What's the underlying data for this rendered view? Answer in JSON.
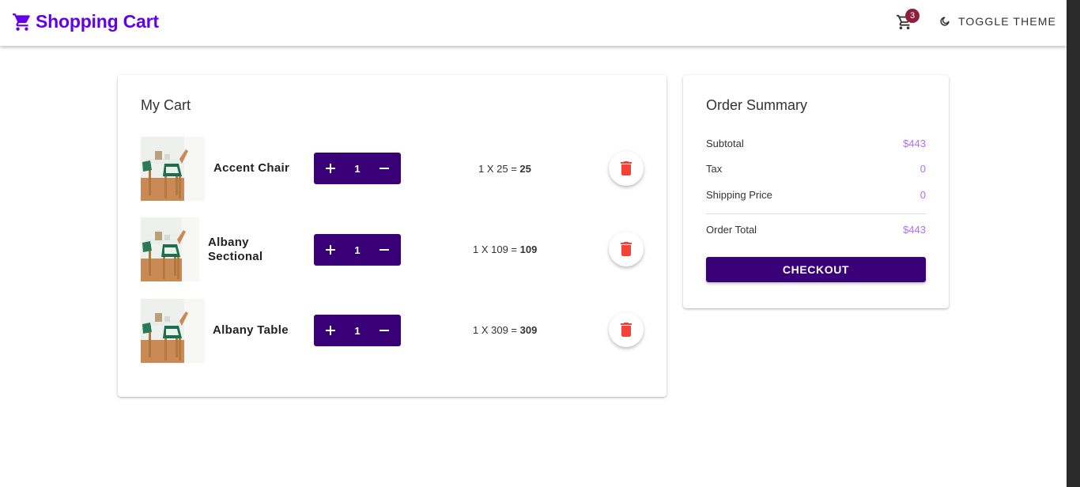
{
  "header": {
    "title": "Shopping Cart",
    "cart_badge": "3",
    "theme_button_label": "TOGGLE THEME"
  },
  "cart": {
    "title": "My Cart",
    "items": [
      {
        "name": "Accent Chair",
        "quantity": "1",
        "line_expr": "1 X 25 = ",
        "line_total": "25"
      },
      {
        "name": "Albany Sectional",
        "quantity": "1",
        "line_expr": "1 X 109 = ",
        "line_total": "109"
      },
      {
        "name": "Albany Table",
        "quantity": "1",
        "line_expr": "1 X 309 = ",
        "line_total": "309"
      }
    ]
  },
  "summary": {
    "title": "Order Summary",
    "subtotal_label": "Subtotal",
    "subtotal_value": "$443",
    "tax_label": "Tax",
    "tax_value": "0",
    "shipping_label": "Shipping Price",
    "shipping_value": "0",
    "total_label": "Order Total",
    "total_value": "$443",
    "checkout_label": "CHECKOUT"
  },
  "colors": {
    "brand": "#6200ea",
    "primary_dark": "#3a0077",
    "price_accent": "#b06ef8",
    "delete_red": "#f44336",
    "badge": "#8e1e3a"
  }
}
